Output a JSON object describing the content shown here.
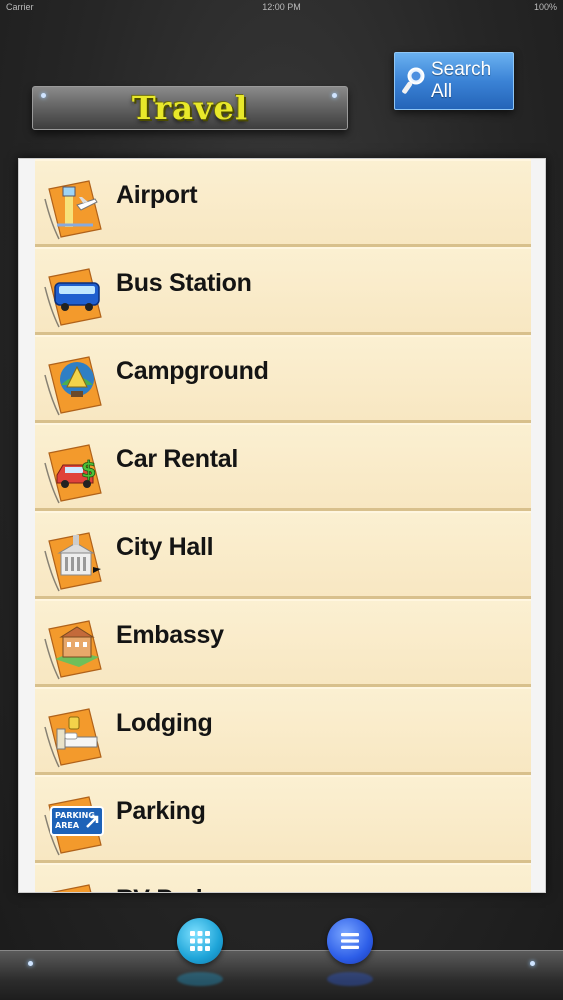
{
  "status_bar": {
    "carrier": "Carrier",
    "time": "12:00 PM",
    "battery": "100%"
  },
  "header": {
    "title": "Travel",
    "search_button_label": "Search All"
  },
  "categories": [
    {
      "label": "Airport",
      "icon": "airport-icon"
    },
    {
      "label": "Bus Station",
      "icon": "bus-icon"
    },
    {
      "label": "Campground",
      "icon": "campground-icon"
    },
    {
      "label": "Car Rental",
      "icon": "car-rental-icon"
    },
    {
      "label": "City Hall",
      "icon": "city-hall-icon"
    },
    {
      "label": "Embassy",
      "icon": "embassy-icon"
    },
    {
      "label": "Lodging",
      "icon": "lodging-icon"
    },
    {
      "label": "Parking",
      "icon": "parking-icon",
      "sign_text": [
        "PARKING",
        "AREA"
      ]
    },
    {
      "label": "RV Park",
      "icon": "rv-park-icon"
    }
  ],
  "bottom_nav": {
    "grid_view": "grid-icon",
    "list_view": "list-icon"
  },
  "colors": {
    "title_yellow": "#e8e82a",
    "search_blue": "#3b83d6",
    "row_bg": "#fbf0d2",
    "card_orange": "#f39a2c"
  }
}
